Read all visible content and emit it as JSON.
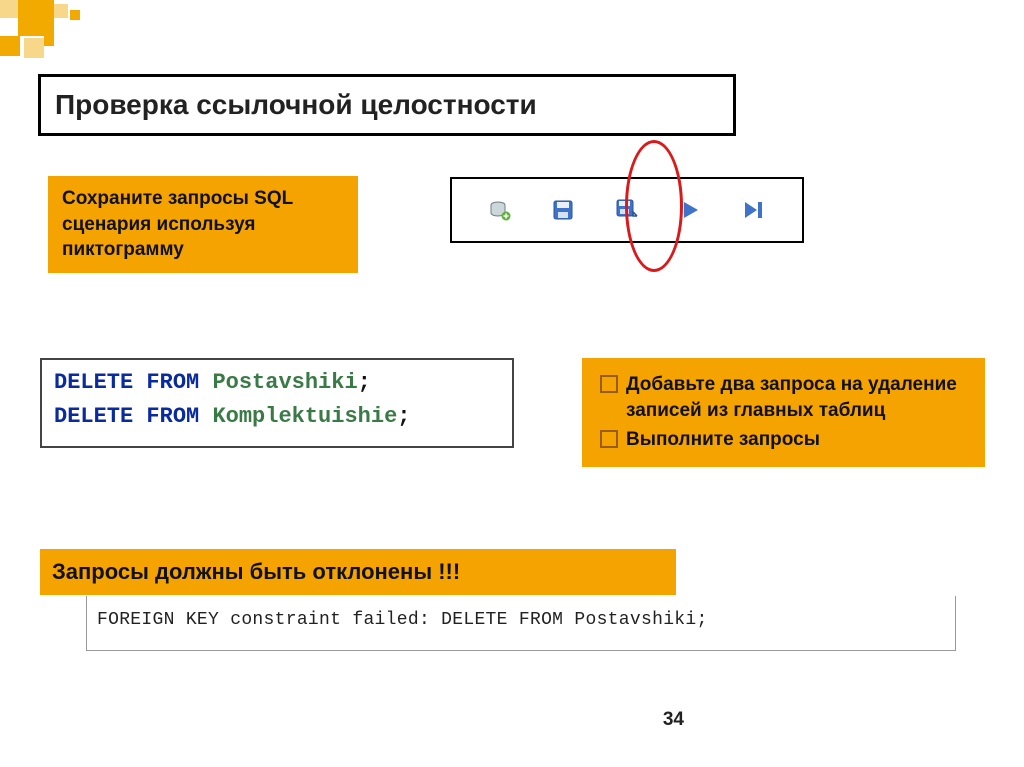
{
  "title": "Проверка ссылочной целостности",
  "instruction_save": "Сохраните запросы SQL сценария используя пиктограмму",
  "toolbar": {
    "icons": [
      "db-add-icon",
      "save-icon",
      "save-as-icon",
      "play-icon",
      "play-end-icon"
    ]
  },
  "sql": {
    "line1": {
      "kw": "DELETE FROM",
      "tbl": "Postavshiki",
      "tail": ";"
    },
    "line2": {
      "kw": "DELETE FROM",
      "tbl": "Komplektuishie",
      "tail": ";"
    }
  },
  "tasks": [
    "Добавьте два запроса на удаление записей из главных таблиц",
    "Выполните запросы"
  ],
  "reject_header": "Запросы должны быть отклонены !!!",
  "error_message": "FOREIGN KEY constraint failed: DELETE FROM Postavshiki;",
  "page_number": "34"
}
